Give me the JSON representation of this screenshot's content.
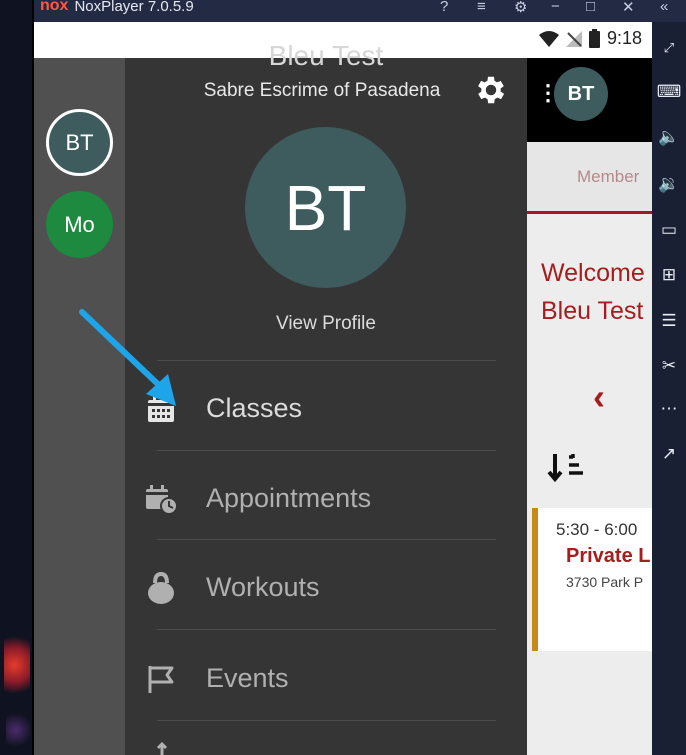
{
  "emulator": {
    "title": "NoxPlayer 7.0.5.9",
    "side_icons": [
      "expand-icon",
      "keyboard-icon",
      "volume-up-icon",
      "volume-down-icon",
      "screen-icon",
      "apk-install-icon",
      "toolbox-icon",
      "scissors-icon",
      "more-icon",
      "open-external-icon"
    ]
  },
  "status_bar": {
    "time": "9:18"
  },
  "accounts": [
    {
      "initials": "BT",
      "color": "#3e5b5e",
      "active": true
    },
    {
      "initials": "Mo",
      "color": "#1d8a3f",
      "active": false
    }
  ],
  "drawer": {
    "user_name": "Bleu Test",
    "org": "Sabre Escrime of Pasadena",
    "avatar_initials": "BT",
    "view_profile": "View Profile",
    "menu": [
      {
        "label": "Classes",
        "icon": "calendar-grid-icon",
        "emphasis": true
      },
      {
        "label": "Appointments",
        "icon": "calendar-clock-icon",
        "emphasis": false
      },
      {
        "label": "Workouts",
        "icon": "kettlebell-icon",
        "emphasis": false
      },
      {
        "label": "Events",
        "icon": "flag-icon",
        "emphasis": false
      }
    ]
  },
  "app": {
    "avatar_initials": "BT",
    "tab_label": "Member",
    "welcome_line1": "Welcome",
    "welcome_line2": "Bleu Test",
    "card": {
      "time": "5:30 - 6:00",
      "title": "Private L",
      "address": "3730 Park P"
    }
  },
  "colors": {
    "accent": "#a51d1d",
    "drawer_bg": "#353535",
    "rail_bg": "#505050",
    "avatar": "#3e5b5e",
    "annotation_arrow": "#1ea5e9"
  }
}
